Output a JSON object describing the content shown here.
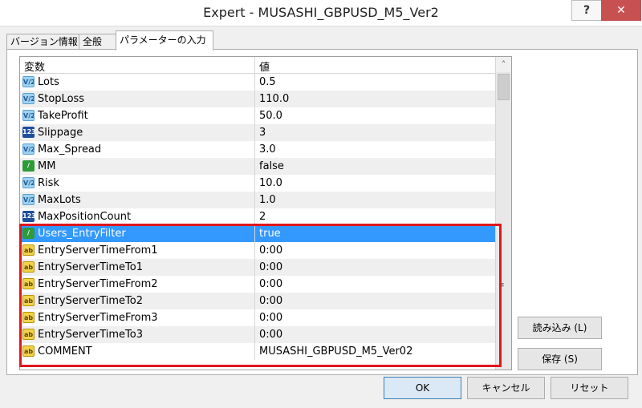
{
  "window": {
    "title": "Expert - MUSASHI_GBPUSD_M5_Ver2",
    "help_label": "?",
    "close_label": "✕"
  },
  "tabs": [
    {
      "label": "バージョン情報"
    },
    {
      "label": "全般"
    },
    {
      "label": "パラメーターの入力"
    }
  ],
  "grid": {
    "headers": {
      "name": "変数",
      "value": "値"
    },
    "scroll_up": "˄",
    "grip": "≡",
    "rows": [
      {
        "icon": "V/2",
        "name": "Lots",
        "value": "0.5"
      },
      {
        "icon": "V/2",
        "name": "StopLoss",
        "value": "110.0"
      },
      {
        "icon": "V/2",
        "name": "TakeProfit",
        "value": "50.0"
      },
      {
        "icon": "123",
        "name": "Slippage",
        "value": "3"
      },
      {
        "icon": "V/2",
        "name": "Max_Spread",
        "value": "3.0"
      },
      {
        "icon": "/",
        "name": "MM",
        "value": "false"
      },
      {
        "icon": "V/2",
        "name": "Risk",
        "value": "10.0"
      },
      {
        "icon": "V/2",
        "name": "MaxLots",
        "value": "1.0"
      },
      {
        "icon": "123",
        "name": "MaxPositionCount",
        "value": "2"
      },
      {
        "icon": "/",
        "name": "Users_EntryFilter",
        "value": "true"
      },
      {
        "icon": "ab",
        "name": "EntryServerTimeFrom1",
        "value": "0:00"
      },
      {
        "icon": "ab",
        "name": "EntryServerTimeTo1",
        "value": "0:00"
      },
      {
        "icon": "ab",
        "name": "EntryServerTimeFrom2",
        "value": "0:00"
      },
      {
        "icon": "ab",
        "name": "EntryServerTimeTo2",
        "value": "0:00"
      },
      {
        "icon": "ab",
        "name": "EntryServerTimeFrom3",
        "value": "0:00"
      },
      {
        "icon": "ab",
        "name": "EntryServerTimeTo3",
        "value": "0:00"
      },
      {
        "icon": "ab",
        "name": "COMMENT",
        "value": "MUSASHI_GBPUSD_M5_Ver02"
      }
    ]
  },
  "buttons": {
    "load": "読み込み (L)",
    "save": "保存 (S)",
    "ok": "OK",
    "cancel": "キャンセル",
    "reset": "リセット"
  }
}
